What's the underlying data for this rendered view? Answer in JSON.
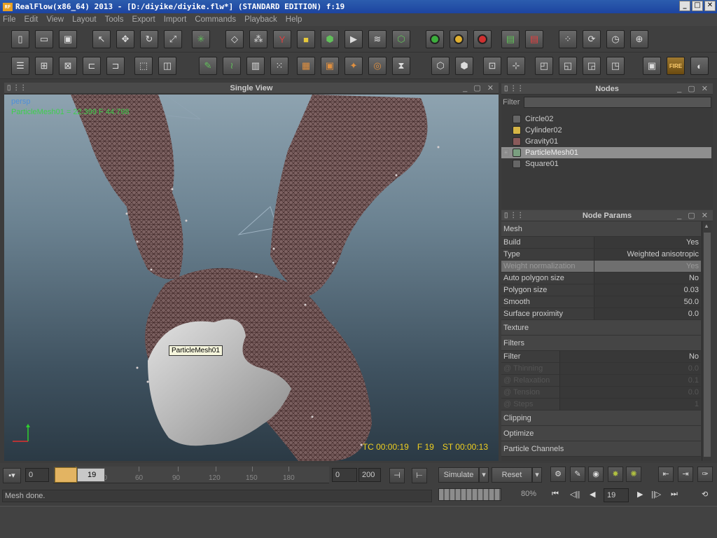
{
  "window": {
    "title": "RealFlow(x86_64) 2013 - [D:/diyike/diyike.flw*] (STANDARD EDITION) f:19",
    "app_icon": "RF",
    "min": "_",
    "max": "□",
    "close": "✕"
  },
  "menu": [
    "File",
    "Edit",
    "View",
    "Layout",
    "Tools",
    "Export",
    "Import",
    "Commands",
    "Playback",
    "Help"
  ],
  "toolbar": {
    "fire_label": "FIRE"
  },
  "viewport": {
    "title": "Single View",
    "camera_label": "persp",
    "stats": "ParticleMesh01 = 22.399 F 44.798",
    "tooltip": "ParticleMesh01",
    "tc": "TC 00:00:19",
    "frame": "F 19",
    "st": "ST 00:00:13"
  },
  "nodes": {
    "title": "Nodes",
    "filter_label": "Filter",
    "items": [
      {
        "name": "Circle02",
        "icon": "emitter-icon"
      },
      {
        "name": "Cylinder02",
        "icon": "object-icon"
      },
      {
        "name": "Gravity01",
        "icon": "daemon-icon"
      },
      {
        "name": "ParticleMesh01",
        "icon": "mesh-icon"
      },
      {
        "name": "Square01",
        "icon": "emitter-icon"
      }
    ]
  },
  "params": {
    "title": "Node Params",
    "sections": {
      "mesh": "Mesh",
      "texture": "Texture",
      "filters": "Filters",
      "clipping": "Clipping",
      "optimize": "Optimize",
      "channels": "Particle Channels"
    },
    "mesh_rows": [
      {
        "name": "Build",
        "value": "Yes"
      },
      {
        "name": "Type",
        "value": "Weighted anisotropic"
      },
      {
        "name": "Weight normalization",
        "value": "Yes"
      },
      {
        "name": "Auto polygon size",
        "value": "No"
      },
      {
        "name": "Polygon size",
        "value": "0.03"
      },
      {
        "name": "Smooth",
        "value": "50.0"
      },
      {
        "name": "Surface proximity",
        "value": "0.0"
      }
    ],
    "filter_rows": [
      {
        "name": "Filter",
        "value": "No"
      },
      {
        "name": "@ Thinning",
        "value": "0.0"
      },
      {
        "name": "@ Relaxation",
        "value": "0.1"
      },
      {
        "name": "@ Tension",
        "value": "0.0"
      },
      {
        "name": "@ Steps",
        "value": "1"
      }
    ]
  },
  "timeline": {
    "start": "0",
    "current": "19",
    "ticks": [
      "30",
      "60",
      "90",
      "120",
      "150",
      "180"
    ],
    "range_start": "0",
    "range_end": "200",
    "simulate": "Simulate",
    "reset": "Reset",
    "frame_field": "19",
    "progress_pct": "80%",
    "status": "Mesh done."
  }
}
